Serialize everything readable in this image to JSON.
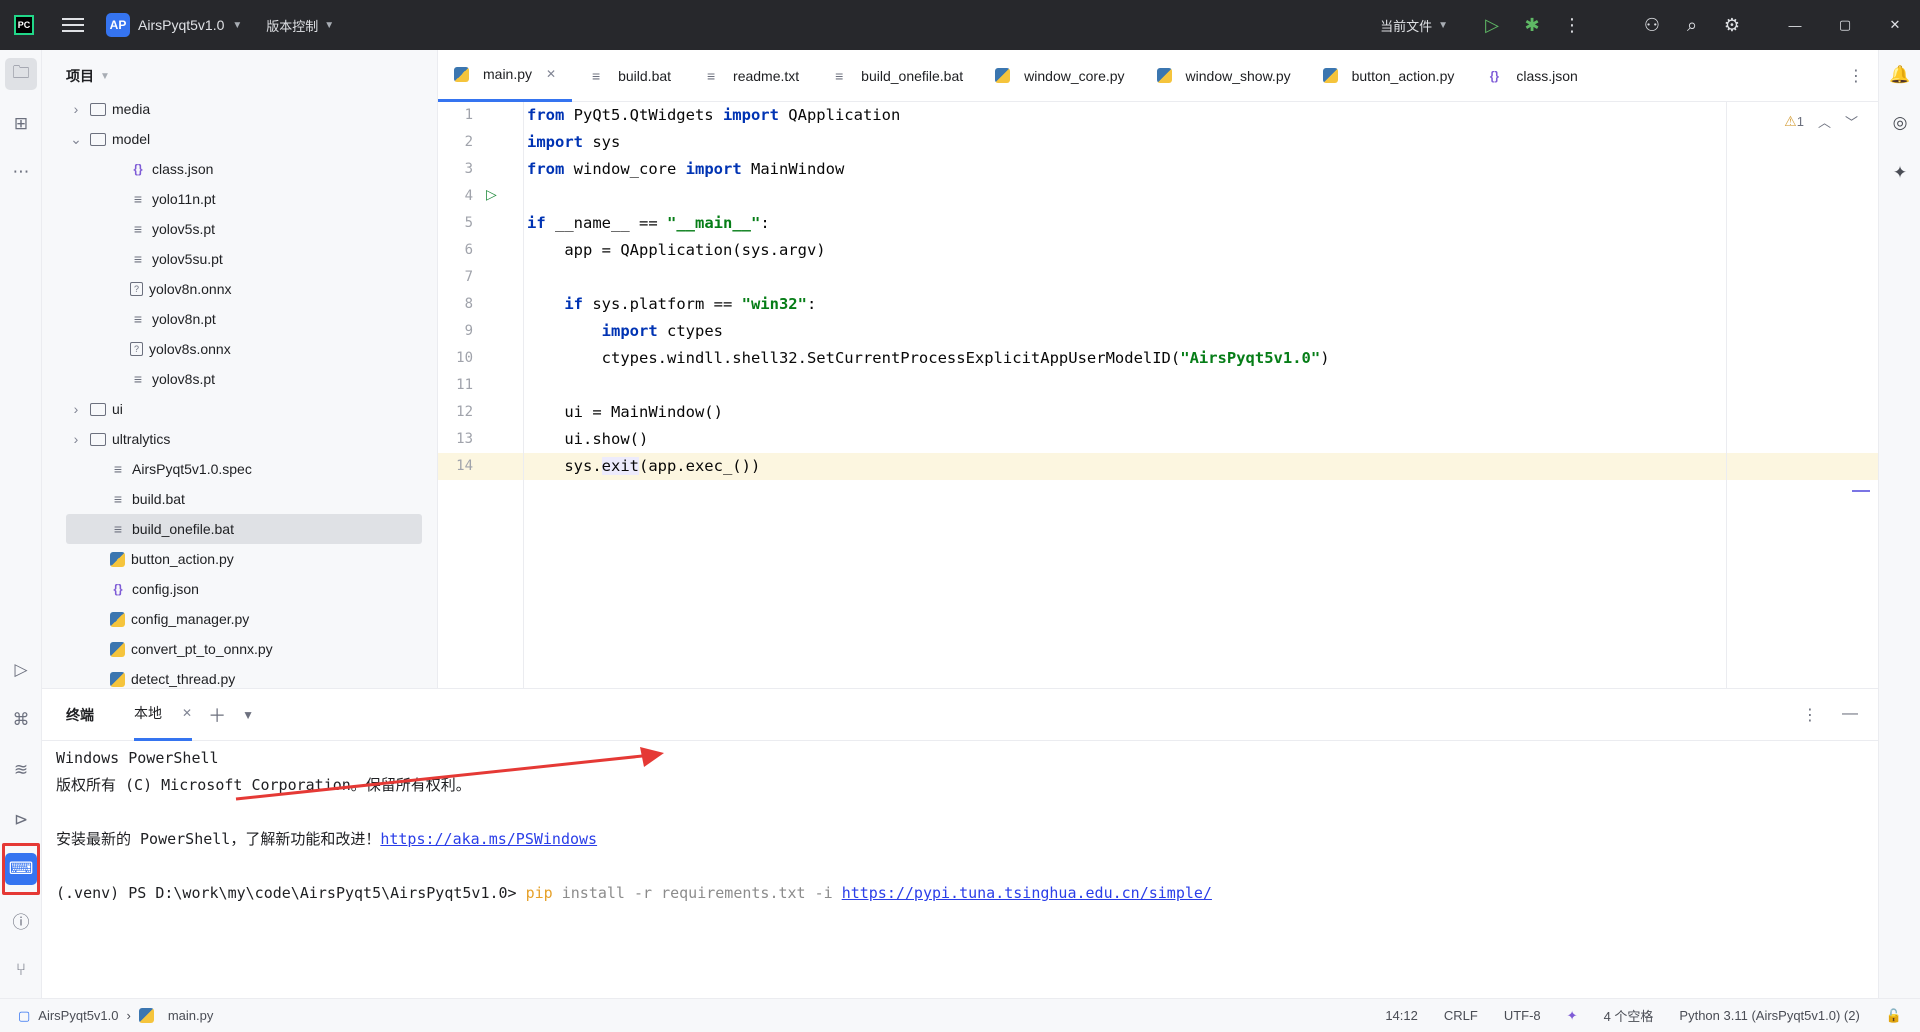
{
  "titlebar": {
    "project_badge": "AP",
    "project_name": "AirsPyqt5v1.0",
    "vcs_label": "版本控制",
    "run_config": "当前文件"
  },
  "project_panel": {
    "title": "项目",
    "tree": [
      {
        "label": "media",
        "type": "folder",
        "indent": 1,
        "expanded": false
      },
      {
        "label": "model",
        "type": "folder",
        "indent": 1,
        "expanded": true
      },
      {
        "label": "class.json",
        "type": "json",
        "indent": 3
      },
      {
        "label": "yolo11n.pt",
        "type": "text",
        "indent": 3
      },
      {
        "label": "yolov5s.pt",
        "type": "text",
        "indent": 3
      },
      {
        "label": "yolov5su.pt",
        "type": "text",
        "indent": 3
      },
      {
        "label": "yolov8n.onnx",
        "type": "unknown",
        "indent": 3
      },
      {
        "label": "yolov8n.pt",
        "type": "text",
        "indent": 3
      },
      {
        "label": "yolov8s.onnx",
        "type": "unknown",
        "indent": 3
      },
      {
        "label": "yolov8s.pt",
        "type": "text",
        "indent": 3
      },
      {
        "label": "ui",
        "type": "folder",
        "indent": 1,
        "expanded": false
      },
      {
        "label": "ultralytics",
        "type": "folder",
        "indent": 1,
        "expanded": false
      },
      {
        "label": "AirsPyqt5v1.0.spec",
        "type": "text",
        "indent": 2
      },
      {
        "label": "build.bat",
        "type": "text",
        "indent": 2
      },
      {
        "label": "build_onefile.bat",
        "type": "text",
        "indent": 2,
        "selected": true
      },
      {
        "label": "button_action.py",
        "type": "py",
        "indent": 2
      },
      {
        "label": "config.json",
        "type": "json",
        "indent": 2
      },
      {
        "label": "config_manager.py",
        "type": "py",
        "indent": 2
      },
      {
        "label": "convert_pt_to_onnx.py",
        "type": "py",
        "indent": 2
      },
      {
        "label": "detect_thread.py",
        "type": "py",
        "indent": 2
      }
    ]
  },
  "editor_tabs": [
    {
      "label": "main.py",
      "icon": "python-file-icon",
      "active": true
    },
    {
      "label": "build.bat",
      "icon": "text-file-icon"
    },
    {
      "label": "readme.txt",
      "icon": "text-file-icon"
    },
    {
      "label": "build_onefile.bat",
      "icon": "text-file-icon"
    },
    {
      "label": "window_core.py",
      "icon": "python-file-icon"
    },
    {
      "label": "window_show.py",
      "icon": "python-file-icon"
    },
    {
      "label": "button_action.py",
      "icon": "python-file-icon"
    },
    {
      "label": "class.json",
      "icon": "json-file-icon"
    }
  ],
  "editor": {
    "warning_count": "1",
    "line_numbers": [
      "1",
      "2",
      "3",
      "4",
      "5",
      "6",
      "7",
      "8",
      "9",
      "10",
      "11",
      "12",
      "13",
      "14"
    ]
  },
  "terminal": {
    "title": "终端",
    "tab_label": "本地",
    "lines": {
      "l1": "Windows PowerShell",
      "l2": "版权所有 (C) Microsoft Corporation。保留所有权利。",
      "l3_text": "安装最新的 PowerShell，了解新功能和改进！",
      "l3_link": "https://aka.ms/PSWindows",
      "prompt": "(.venv) PS D:\\work\\my\\code\\AirsPyqt5\\AirsPyqt5v1.0> ",
      "cmd_pip": "pip",
      "cmd_args": " install -r requirements.txt -i ",
      "cmd_link": "https://pypi.tuna.tsinghua.edu.cn/simple/"
    }
  },
  "statusbar": {
    "project": "AirsPyqt5v1.0",
    "file": "main.py",
    "position": "14:12",
    "line_sep": "CRLF",
    "encoding": "UTF-8",
    "indent": "4 个空格",
    "interpreter": "Python 3.11 (AirsPyqt5v1.0) (2)"
  },
  "colors": {
    "accent": "#3574f0",
    "annotation_red": "#e53935"
  }
}
